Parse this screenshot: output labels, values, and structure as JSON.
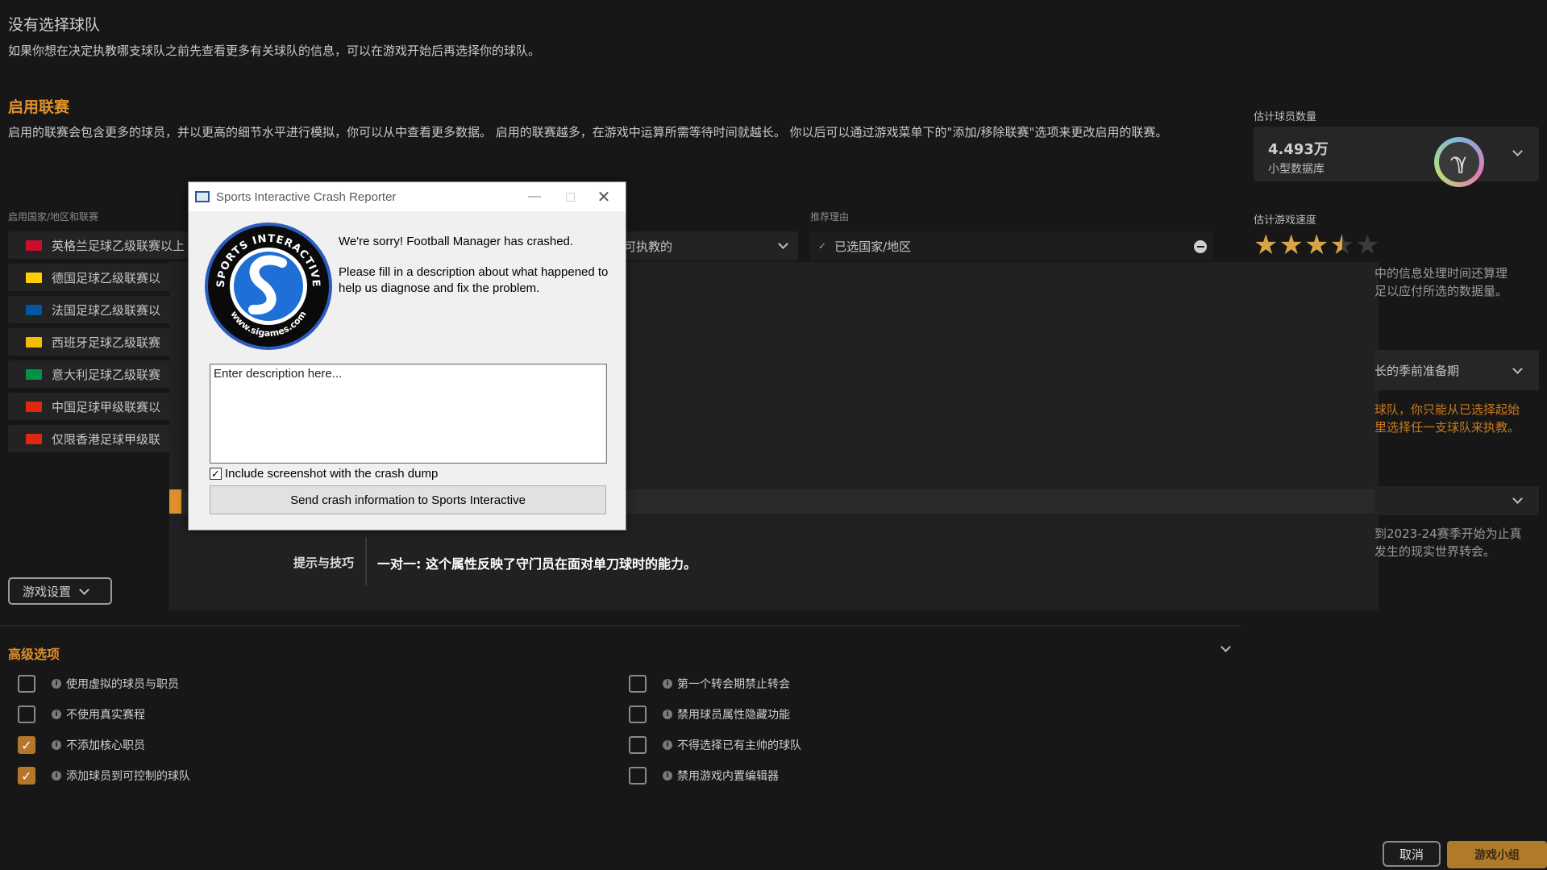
{
  "team": {
    "title": "没有选择球队",
    "desc": "如果你想在决定执教哪支球队之前先查看更多有关球队的信息，可以在游戏开始后再选择你的球队。"
  },
  "leagues": {
    "title": "启用联赛",
    "desc": "启用的联赛会包含更多的球员，并以更高的细节水平进行模拟，你可以从中查看更多数据。 启用的联赛越多，在游戏中运算所需等待时间就越长。 你以后可以通过游戏菜单下的\"添加/移除联赛\"选项来更改启用的联赛。",
    "col_countries": "启用国家/地区和联赛",
    "col_reason": "推荐理由",
    "items": [
      {
        "label": "英格兰足球乙级联赛以上",
        "flag_color": "#c8102e"
      },
      {
        "label": "德国足球乙级联赛以",
        "flag_color": "#ffce00"
      },
      {
        "label": "法国足球乙级联赛以",
        "flag_color": "#0055a4"
      },
      {
        "label": "西班牙足球乙级联赛",
        "flag_color": "#f1bf00"
      },
      {
        "label": "意大利足球乙级联赛",
        "flag_color": "#009246"
      },
      {
        "label": "中国足球甲级联赛以",
        "flag_color": "#de2910"
      },
      {
        "label": "仅限香港足球甲级联",
        "flag_color": "#de2910"
      }
    ],
    "dropdown_value": "可执教的",
    "reason_value": "已选国家/地区"
  },
  "right": {
    "players_label": "估计球员数量",
    "players_count": "4.493万",
    "players_db": "小型数据库",
    "speed_label": "估计游戏速度",
    "speed_rating": 3.5,
    "speed_desc_1": "中的信息处理时间还算理",
    "speed_desc_2": "足以应付所选的数据量。",
    "prep_label": "长的季前准备期",
    "orange_note_1": "球队，你只能从已选择起始",
    "orange_note_2": "里选择任一支球队来执教。",
    "transfer_note_1": "到2023-24赛季开始为止真",
    "transfer_note_2": "发生的现实世界转会。"
  },
  "tips": {
    "label": "提示与技巧",
    "text": "一对一: 这个属性反映了守门员在面对单刀球时的能力。"
  },
  "loading_progress": 0.01,
  "game_settings_label": "游戏设置",
  "advanced": {
    "title": "高级选项",
    "left": [
      {
        "label": "使用虚拟的球员与职员",
        "checked": false
      },
      {
        "label": "不使用真实赛程",
        "checked": false
      },
      {
        "label": "不添加核心职员",
        "checked": true
      },
      {
        "label": "添加球员到可控制的球队",
        "checked": true
      }
    ],
    "right": [
      {
        "label": "第一个转会期禁止转会",
        "checked": false
      },
      {
        "label": "禁用球员属性隐藏功能",
        "checked": false
      },
      {
        "label": "不得选择已有主帅的球队",
        "checked": false
      },
      {
        "label": "禁用游戏内置编辑器",
        "checked": false
      }
    ]
  },
  "cancel_label": "取消",
  "watermark_text": "游戏小组",
  "dialog": {
    "title": "Sports Interactive Crash Reporter",
    "msg1": "We're sorry! Football Manager has crashed.",
    "msg2": "Please fill in a description about what happened to help us diagnose and fix the problem.",
    "textarea_value": "Enter description here...",
    "checkbox_label": "Include screenshot with the crash dump",
    "checkbox_checked": true,
    "send_label": "Send crash information to Sports Interactive",
    "logo_text_top": "SPORTS INTERACTIVE",
    "logo_text_bottom": "www.sigames.com"
  },
  "colors": {
    "accent": "#e0902a",
    "background": "#171717",
    "star": "#d7a546"
  }
}
